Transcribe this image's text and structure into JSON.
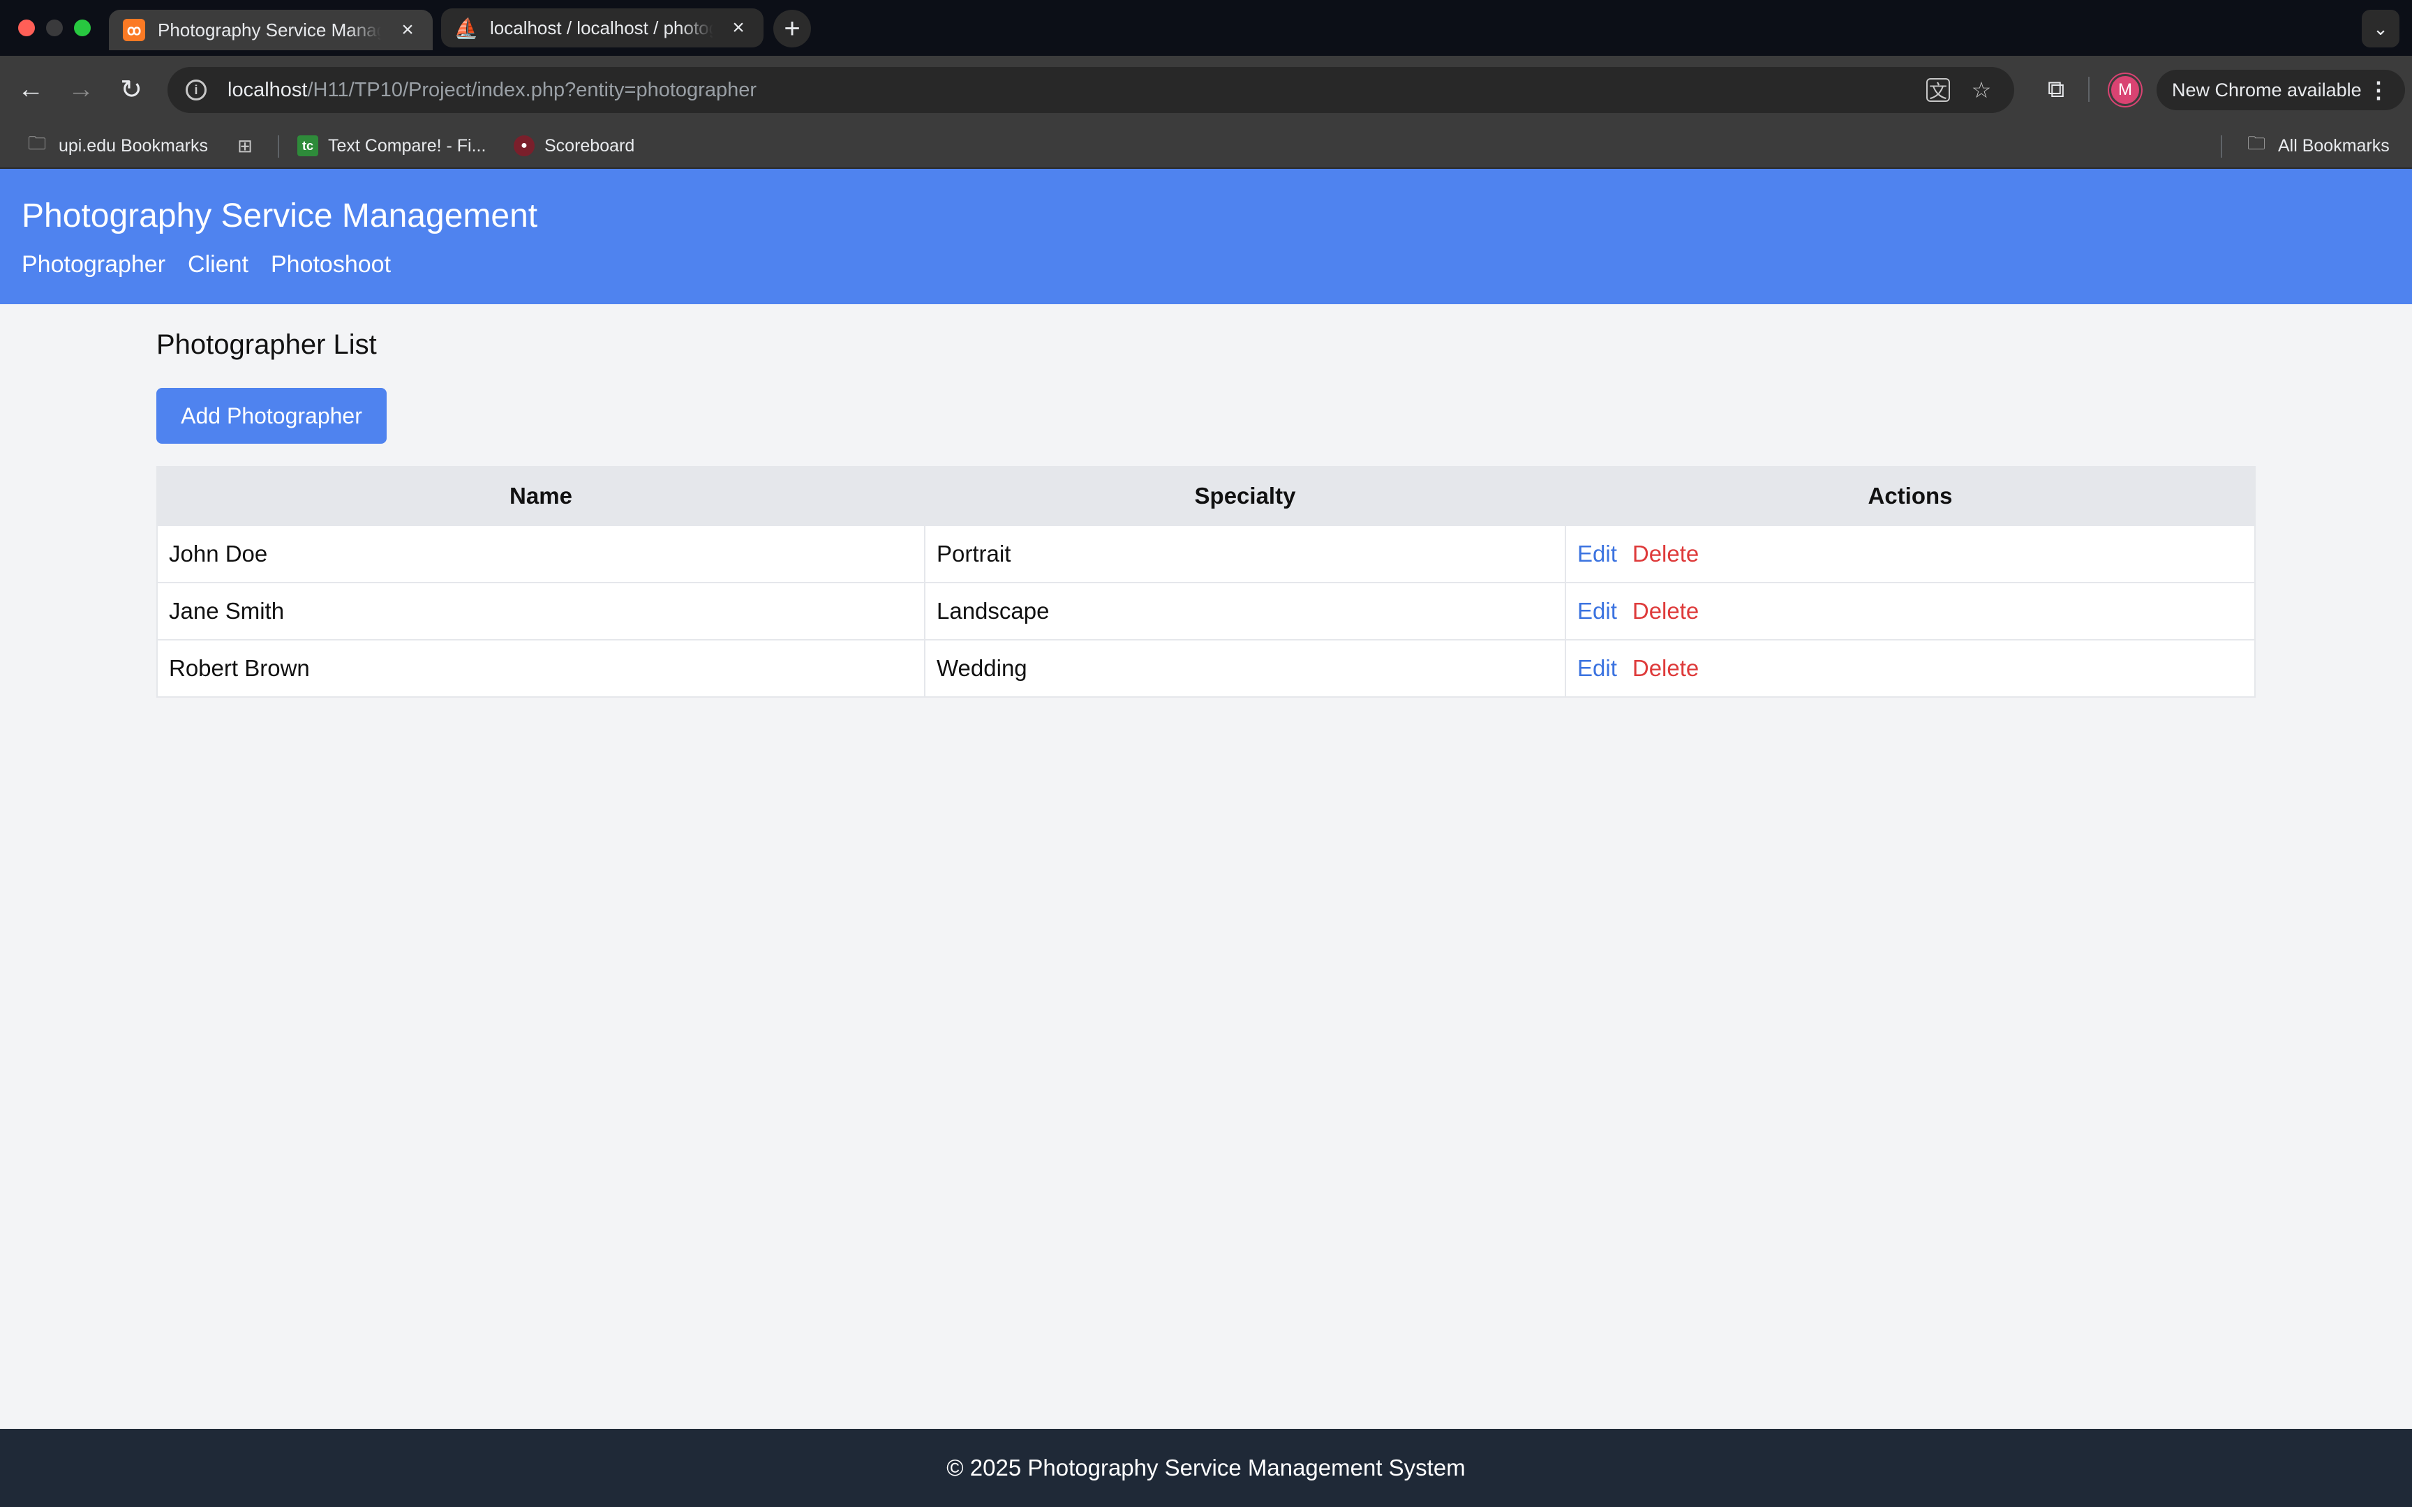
{
  "browser": {
    "tabs": [
      {
        "title": "Photography Service Management",
        "active": true,
        "favicon": "xampp-icon"
      },
      {
        "title": "localhost / localhost / photographer",
        "active": false,
        "favicon": "phpmyadmin-icon"
      }
    ],
    "url": {
      "host": "localhost",
      "path": "/H11/TP10/Project/index.php?entity=photographer"
    },
    "update_label": "New Chrome available",
    "avatar_letter": "M",
    "bookmarks": [
      {
        "label": "upi.edu Bookmarks",
        "icon": "managed-folder-icon"
      },
      {
        "label": "Text Compare! - Fi...",
        "icon": "textcompare-icon"
      },
      {
        "label": "Scoreboard",
        "icon": "scoreboard-icon"
      }
    ],
    "all_bookmarks_label": "All Bookmarks"
  },
  "site": {
    "title": "Photography Service Management",
    "nav": [
      "Photographer",
      "Client",
      "Photoshoot"
    ],
    "accent_color": "#4f83ef"
  },
  "main": {
    "list_title": "Photographer List",
    "add_button": "Add Photographer",
    "columns": [
      "Name",
      "Specialty",
      "Actions"
    ],
    "rows": [
      {
        "name": "John Doe",
        "specialty": "Portrait",
        "edit": "Edit",
        "delete": "Delete"
      },
      {
        "name": "Jane Smith",
        "specialty": "Landscape",
        "edit": "Edit",
        "delete": "Delete"
      },
      {
        "name": "Robert Brown",
        "specialty": "Wedding",
        "edit": "Edit",
        "delete": "Delete"
      }
    ]
  },
  "footer": {
    "text": "© 2025 Photography Service Management System"
  }
}
